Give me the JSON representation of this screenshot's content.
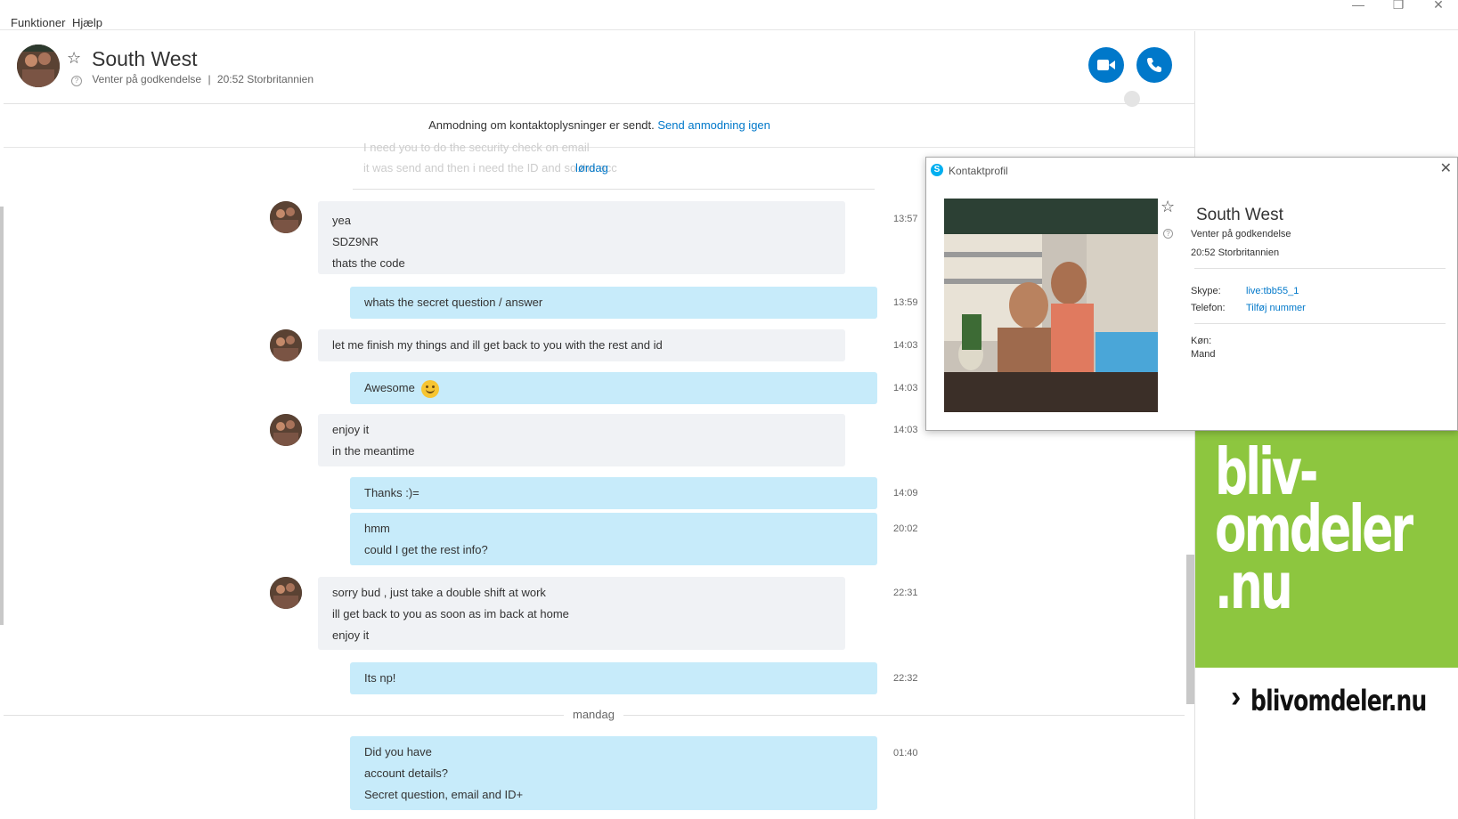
{
  "menu": {
    "items": [
      "Funktioner",
      "Hjælp"
    ]
  },
  "window_controls": {
    "minimize": "—",
    "maximize": "❐",
    "close": "✕"
  },
  "header": {
    "name": "South West",
    "status": "Venter på godkendelse",
    "separator": "|",
    "local_time": "20:52 Storbritannien"
  },
  "notice": {
    "text": "Anmodning om kontaktoplysninger er sendt.",
    "link": "Send anmodning igen"
  },
  "faded_messages": [
    "I need you to do the security check on email",
    "it was send and then i need the ID and so the acc"
  ],
  "day_labels": {
    "saturday": "lørdag",
    "monday": "mandag"
  },
  "messages": [
    {
      "dir": "in",
      "lines": [
        "yea",
        "SDZ9NR",
        "thats the code"
      ],
      "time": "13:57"
    },
    {
      "dir": "out",
      "lines": [
        "whats the secret question / answer"
      ],
      "time": "13:59"
    },
    {
      "dir": "in",
      "lines": [
        "let me finish my things and ill get back to you with the rest and id"
      ],
      "time": "14:03"
    },
    {
      "dir": "out",
      "lines": [
        "Awesome"
      ],
      "emoji": "smile",
      "time": "14:03"
    },
    {
      "dir": "in",
      "lines": [
        "enjoy it",
        "in the meantime"
      ],
      "time": "14:03"
    },
    {
      "dir": "out",
      "lines": [
        "Thanks :)="
      ],
      "time": "14:09"
    },
    {
      "dir": "out",
      "lines": [
        "hmm",
        "could I get the rest info?"
      ],
      "time": "20:02"
    },
    {
      "dir": "in",
      "lines": [
        "sorry bud , just take a double shift at work",
        "ill get back to you as soon as im back at home",
        "enjoy it"
      ],
      "time": "22:31"
    },
    {
      "dir": "out",
      "lines": [
        "Its np!"
      ],
      "time": "22:32"
    },
    {
      "dir": "out",
      "lines": [
        "Did you have",
        "account details?",
        "Secret question, email and ID+"
      ],
      "time": "01:40"
    }
  ],
  "profile": {
    "title": "Kontaktprofil",
    "close": "✕",
    "name": "South West",
    "status": "Venter på godkendelse",
    "local_time": "20:52 Storbritannien",
    "skype_label": "Skype:",
    "skype_value": "live:tbb55_1",
    "phone_label": "Telefon:",
    "phone_value": "Tilføj nummer",
    "gender_label": "Køn:",
    "gender_value": "Mand"
  },
  "ad": {
    "lines": [
      "bliv-",
      "omdeler",
      ".nu"
    ],
    "arrow": "›",
    "link": "blivomdeler.nu",
    "colors": {
      "background": "#8dc63f",
      "text": "#ffffff"
    }
  },
  "colors": {
    "accent": "#0078ca",
    "outgoing_bubble": "#c7ebfa",
    "incoming_bubble": "#f0f2f5"
  }
}
